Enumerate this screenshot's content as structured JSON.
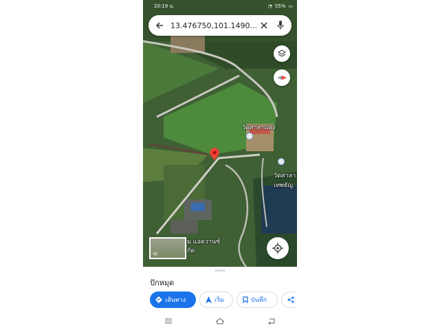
{
  "status_bar": {
    "time": "20:19 น.",
    "battery": "55%"
  },
  "search": {
    "query": "13.476750,101.1490..."
  },
  "map": {
    "labels": [
      "วัดศาลาแดง",
      "วัดศาลา",
      "เทพธัญ",
      "ม แอดวานซ์",
      "กัด"
    ],
    "pin_color": "#ea4335"
  },
  "sheet": {
    "title": "ปักหมุด",
    "buttons": [
      "เส้นทาง",
      "เริ่ม",
      "บันทึก"
    ]
  },
  "colors": {
    "accent": "#1a73e8"
  }
}
